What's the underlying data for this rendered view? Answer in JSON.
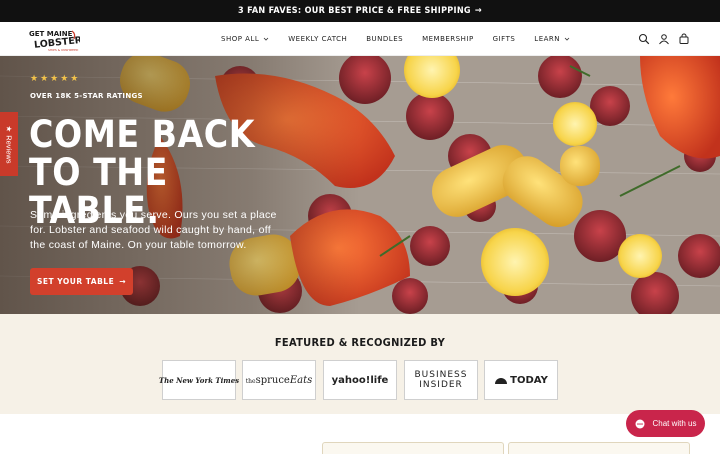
{
  "announcement": {
    "text": "3 FAN FAVES: OUR BEST PRICE & FREE SHIPPING",
    "arrow": "→"
  },
  "header": {
    "logo": {
      "line1": "GET MAINE",
      "line2": "LOBSTER",
      "tagline": "SHIPS & UNSHIPPED"
    },
    "nav": [
      {
        "label": "SHOP ALL",
        "dropdown": true
      },
      {
        "label": "WEEKLY CATCH",
        "dropdown": false
      },
      {
        "label": "BUNDLES",
        "dropdown": false
      },
      {
        "label": "MEMBERSHIP",
        "dropdown": false
      },
      {
        "label": "GIFTS",
        "dropdown": false
      },
      {
        "label": "LEARN",
        "dropdown": true
      }
    ],
    "icons": [
      "search-icon",
      "account-icon",
      "cart-icon"
    ]
  },
  "hero": {
    "stars": "★★★★★",
    "ratings_text": "OVER 18K 5-STAR RATINGS",
    "title_line1": "COME BACK",
    "title_line2": "TO THE TABLE.",
    "description": "Some ingredients you serve. Ours you set a place for. Lobster and seafood wild caught by hand, off the coast of Maine. On your table tomorrow.",
    "cta_label": "SET YOUR TABLE",
    "cta_arrow": "→"
  },
  "reviews_tab": {
    "star": "★",
    "label": "Reviews"
  },
  "featured": {
    "title": "FEATURED & RECOGNIZED BY",
    "logos": [
      {
        "name": "The New York Times"
      },
      {
        "name_pre": "the",
        "name_main": "spruce",
        "name_script": "Eats"
      },
      {
        "name": "yahoo!life"
      },
      {
        "line1": "BUSINESS",
        "line2": "INSIDER"
      },
      {
        "name": "TODAY"
      }
    ]
  },
  "chat": {
    "label": "Chat with us"
  },
  "colors": {
    "cta": "#d2402c",
    "announce_bg": "#111111",
    "featured_bg": "#f6f1e7",
    "chat": "#c9254b",
    "star": "#f2c24a"
  }
}
